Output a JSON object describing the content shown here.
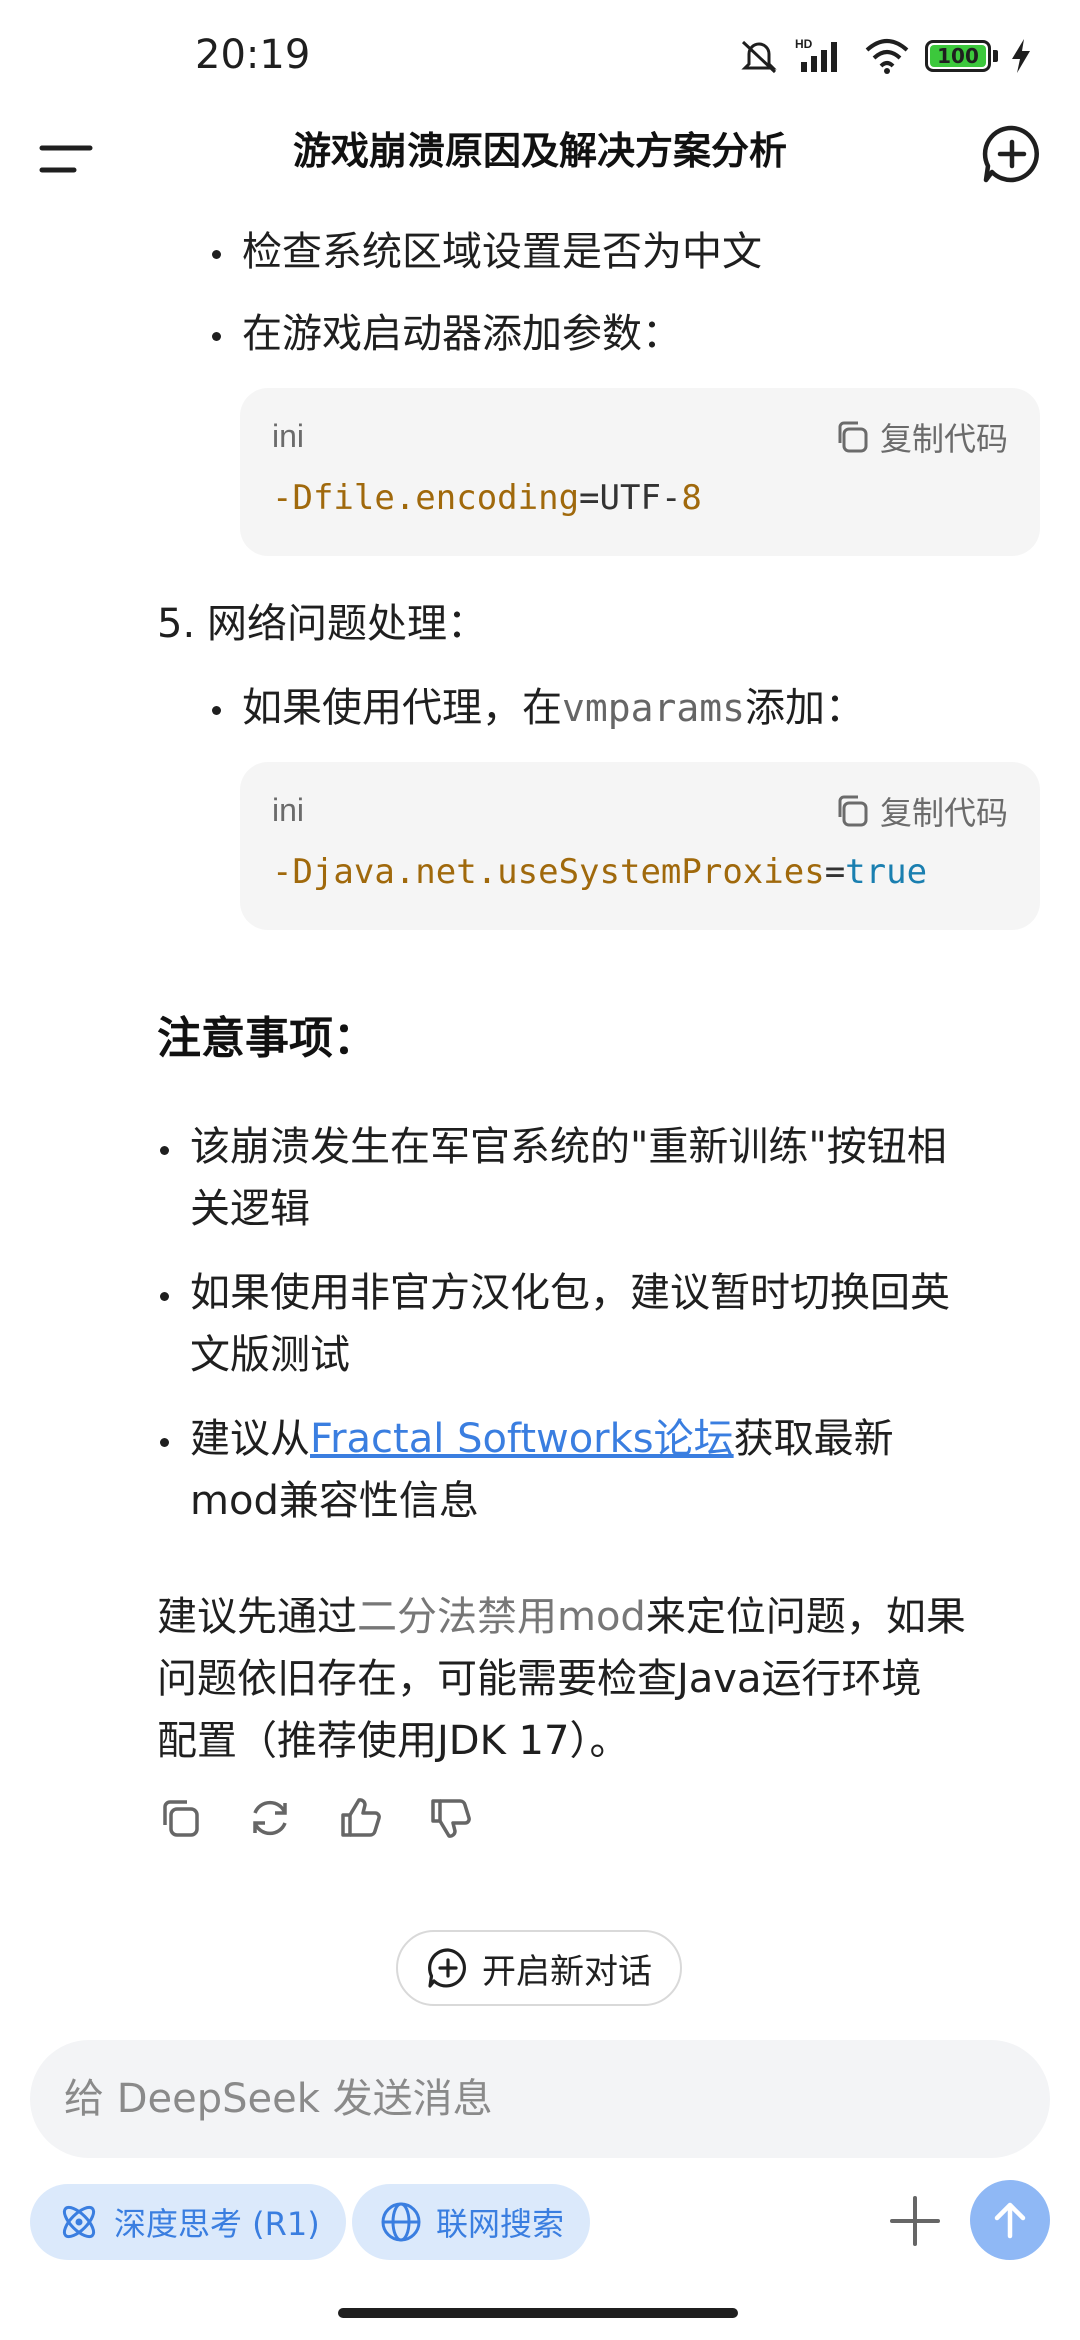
{
  "status_bar": {
    "time": "20:19",
    "battery_level": "100",
    "icons": [
      "mute-icon",
      "hd-signal-icon",
      "wifi-icon",
      "battery-icon",
      "charging-icon"
    ]
  },
  "header": {
    "title": "游戏崩溃原因及解决方案分析",
    "menu_icon": "menu-icon",
    "new_chat_icon": "new-chat-icon"
  },
  "content": {
    "bullet_region": "检查系统区域设置是否为中文",
    "bullet_params": "在游戏启动器添加参数：",
    "code1": {
      "lang": "ini",
      "copy_label": "复制代码",
      "option": "-Dfile.encoding",
      "equals": "=",
      "value": "UTF-",
      "value_num": "8"
    },
    "step5_number": "5.",
    "step5_label": "网络问题处理：",
    "bullet_proxy_prefix": "如果使用代理，在",
    "bullet_proxy_code": "vmparams",
    "bullet_proxy_suffix": "添加：",
    "code2": {
      "lang": "ini",
      "copy_label": "复制代码",
      "option": "-Djava.net.useSystemProxies",
      "equals": "=",
      "value": "true"
    },
    "notes_title": "注意事项：",
    "note1_line1": "该崩溃发生在军官系统的\"重新训练\"按钮相",
    "note1_line2": "关逻辑",
    "note2_line1": "如果使用非官方汉化包，建议暂时切换回英",
    "note2_line2": "文版测试",
    "note3_prefix": "建议从",
    "note3_link": "Fractal Softworks论坛",
    "note3_suffix": "获取最新",
    "note3_line2": "mod兼容性信息",
    "summary_line1_a": "建议先通过",
    "summary_line1_muted": "二分法禁用mod",
    "summary_line1_b": "来定位问题，如果",
    "summary_line2": "问题依旧存在，可能需要检查Java运行环境",
    "summary_line3": "配置（推荐使用JDK 17）。"
  },
  "actions": {
    "icons": [
      "copy-icon",
      "regenerate-icon",
      "thumbs-up-icon",
      "thumbs-down-icon"
    ]
  },
  "new_conversation_label": "开启新对话",
  "input": {
    "placeholder": "给 DeepSeek 发送消息"
  },
  "chips": {
    "deep_think": "深度思考 (R1)",
    "web_search": "联网搜索"
  },
  "colors": {
    "accent": "#3a7ee0",
    "chip_bg": "#dbe9fb",
    "send_bg": "#8fb8f5",
    "code_option": "#a0690c",
    "code_bool": "#1a7fb0"
  }
}
